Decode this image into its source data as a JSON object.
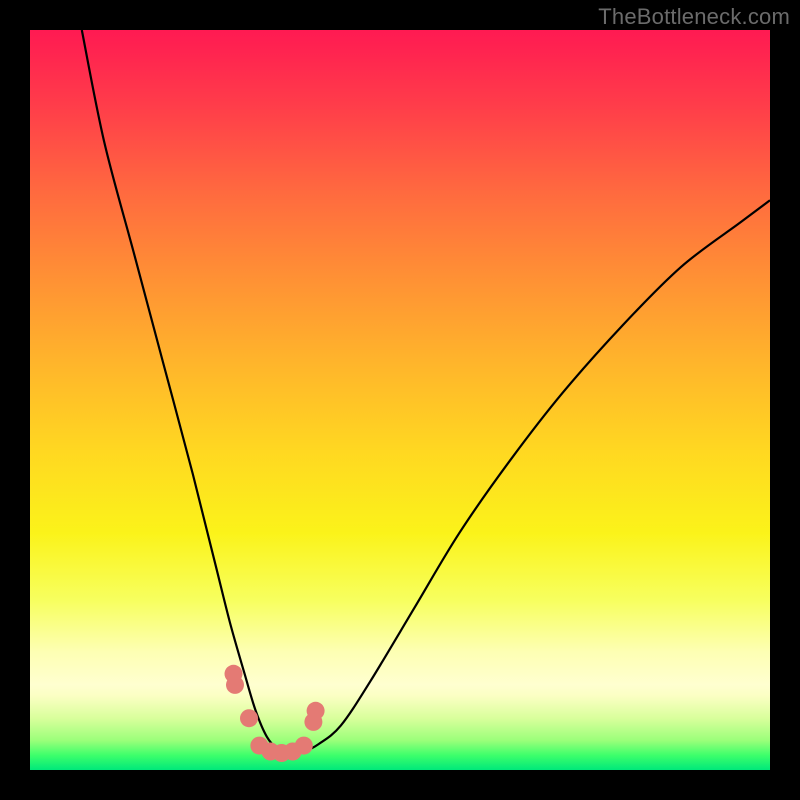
{
  "watermark": "TheBottleneck.com",
  "chart_data": {
    "type": "line",
    "title": "",
    "xlabel": "",
    "ylabel": "",
    "xlim": [
      0,
      100
    ],
    "ylim": [
      0,
      100
    ],
    "grid": false,
    "series": [
      {
        "name": "curve",
        "x": [
          7,
          10,
          14,
          18,
          22,
          25,
          27,
          29,
          30.5,
          32,
          33.5,
          35,
          37,
          39,
          42,
          46,
          52,
          58,
          65,
          72,
          80,
          88,
          96,
          100
        ],
        "values": [
          100,
          85,
          70,
          55,
          40,
          28,
          20,
          13,
          8,
          4.5,
          2.8,
          2.3,
          2.5,
          3.5,
          6,
          12,
          22,
          32,
          42,
          51,
          60,
          68,
          74,
          77
        ]
      }
    ],
    "markers": {
      "name": "highlighted-points",
      "x": [
        27.5,
        27.7,
        29.6,
        31.0,
        32.5,
        34.0,
        35.5,
        37.0,
        38.3,
        38.6
      ],
      "values": [
        13.0,
        11.5,
        7.0,
        3.3,
        2.5,
        2.3,
        2.5,
        3.3,
        6.5,
        8.0
      ]
    },
    "colors": {
      "curve": "#000000",
      "marker": "#e47a74",
      "gradient_top": "#ff1a52",
      "gradient_bottom": "#00e87a"
    }
  }
}
